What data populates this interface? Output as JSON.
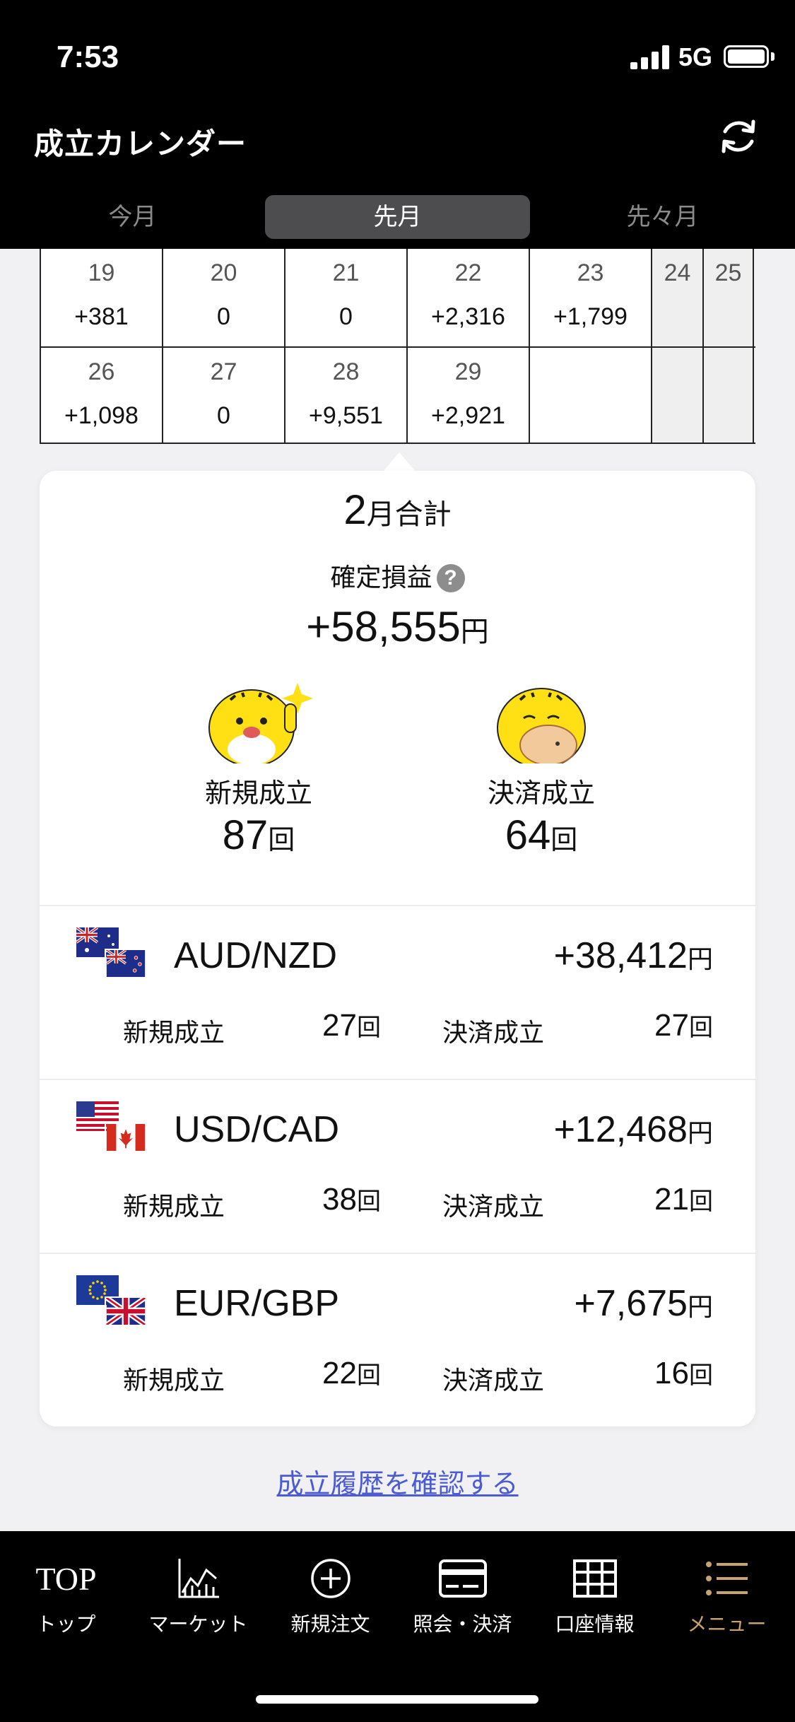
{
  "status_bar": {
    "time": "7:53",
    "network": "5G"
  },
  "header": {
    "title": "成立カレンダー",
    "refresh_icon": "refresh-icon"
  },
  "tabs": [
    {
      "label": "今月",
      "selected": false
    },
    {
      "label": "先月",
      "selected": true
    },
    {
      "label": "先々月",
      "selected": false
    }
  ],
  "calendar": {
    "rows": [
      {
        "days": [
          "19",
          "20",
          "21",
          "22",
          "23",
          "24",
          "25"
        ],
        "values": [
          "+381",
          "0",
          "0",
          "+2,316",
          "+1,799",
          "",
          ""
        ]
      },
      {
        "days": [
          "26",
          "27",
          "28",
          "29",
          "",
          "",
          ""
        ],
        "values": [
          "+1,098",
          "0",
          "+9,551",
          "+2,921",
          "",
          "",
          ""
        ]
      }
    ]
  },
  "summary": {
    "month_number": "2",
    "month_suffix": "月合計",
    "pl_label": "確定損益",
    "help_icon": "?",
    "pl_value": "+58,555",
    "currency": "円",
    "new_label": "新規成立",
    "new_count": "87",
    "close_label": "決済成立",
    "close_count": "64",
    "count_unit": "回"
  },
  "pairs": [
    {
      "name": "AUD/NZD",
      "pl": "+38,412",
      "new_count": "27",
      "close_count": "27",
      "flags": [
        "australia-flag",
        "new-zealand-flag"
      ]
    },
    {
      "name": "USD/CAD",
      "pl": "+12,468",
      "new_count": "38",
      "close_count": "21",
      "flags": [
        "usa-flag",
        "canada-flag"
      ]
    },
    {
      "name": "EUR/GBP",
      "pl": "+7,675",
      "new_count": "22",
      "close_count": "16",
      "flags": [
        "eu-flag",
        "uk-flag"
      ]
    }
  ],
  "pair_labels": {
    "new_label": "新規成立",
    "close_label": "決済成立",
    "unit": "回",
    "currency": "円"
  },
  "history_link": "成立履歴を確認する",
  "bottom_nav": [
    {
      "icon_text": "TOP",
      "label": "トップ",
      "active": false
    },
    {
      "icon": "chart-icon",
      "label": "マーケット",
      "active": false
    },
    {
      "icon": "plus-circle-icon",
      "label": "新規注文",
      "active": false
    },
    {
      "icon": "card-icon",
      "label": "照会・決済",
      "active": false
    },
    {
      "icon": "grid-icon",
      "label": "口座情報",
      "active": false
    },
    {
      "icon": "menu-icon",
      "label": "メニュー",
      "active": true
    }
  ],
  "colors": {
    "active_nav": "#c9a46a",
    "link": "#4b5bd6",
    "header_bg": "#000000"
  }
}
